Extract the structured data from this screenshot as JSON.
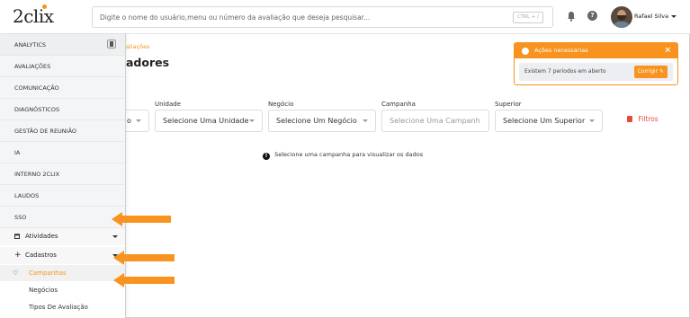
{
  "header": {
    "logo": "2clix",
    "search_placeholder": "Digite o nome do usuário,menu ou número da avaliação que deseja pesquisar...",
    "shortcut": "CTRL + /",
    "help": "?",
    "user_name": "Rafael Silva"
  },
  "sidebar": {
    "menu": [
      "ANALYTICS",
      "AVALIAÇÕES",
      "COMUNICAÇÃO",
      "DIAGNÓSTICOS",
      "GESTÃO DE REUNIÃO",
      "IA",
      "INTERNO 2CLIX",
      "LAUDOS",
      "SSO"
    ],
    "sections": [
      "Atividades",
      "Cadastros"
    ],
    "sub_items": [
      "Campanhas",
      "Negócios",
      "Tipos De Avaliação"
    ],
    "active_item": "Campanhas"
  },
  "main": {
    "breadcrumb": "aliações",
    "title": "adores",
    "filters": [
      {
        "label": "",
        "value": "o"
      },
      {
        "label": "Unidade",
        "value": "Selecione Uma Unidade"
      },
      {
        "label": "Negócio",
        "value": "Selecione Um Negócio"
      },
      {
        "label": "Campanha",
        "value": "Selecione Uma Campanh"
      },
      {
        "label": "Superior",
        "value": "Selecione Um Superior"
      }
    ],
    "filters_button": "Filtros",
    "hint": "Selecione uma campanha para visualizar os dados",
    "hint_icon": "!"
  },
  "alert": {
    "title": "Ações necessárias",
    "close": "×",
    "message": "Existem 7 períodos em aberto",
    "fix_button": "Corrigir"
  },
  "colors": {
    "accent": "#f7931e",
    "danger": "#e64a3c",
    "annotation_arrow": "#f7931e"
  }
}
